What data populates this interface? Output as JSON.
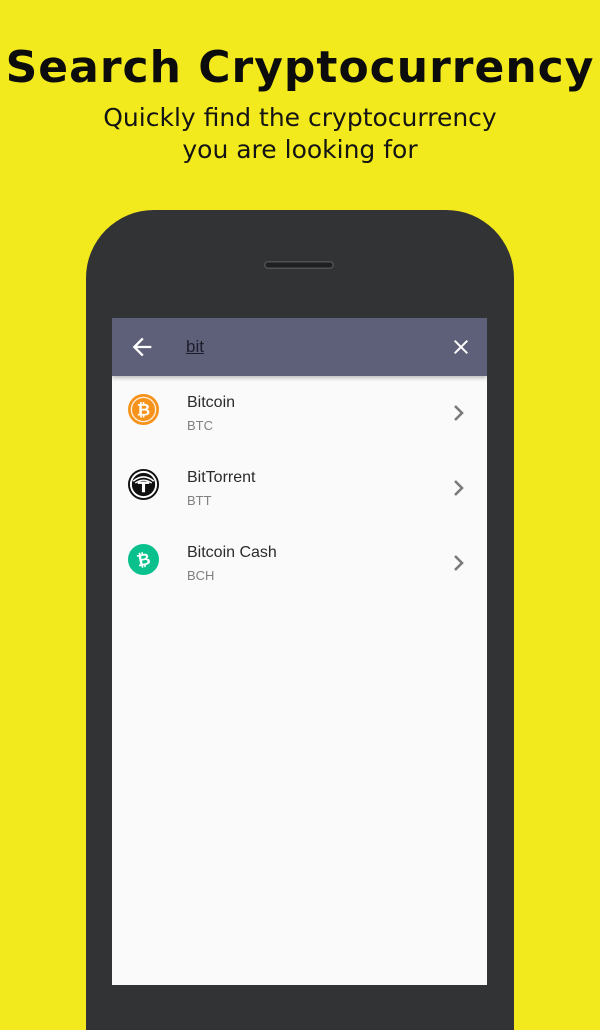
{
  "promo": {
    "title": "Search Cryptocurrency",
    "subtitle_line1": "Quickly find the cryptocurrency",
    "subtitle_line2": "you are looking for"
  },
  "search": {
    "query": "bit",
    "back_icon": "arrow-left-icon",
    "clear_icon": "close-icon"
  },
  "results": [
    {
      "name": "Bitcoin",
      "symbol": "BTC",
      "icon": "bitcoin-icon",
      "color": "#f7931a"
    },
    {
      "name": "BitTorrent",
      "symbol": "BTT",
      "icon": "bittorrent-icon",
      "color": "#111111"
    },
    {
      "name": "Bitcoin Cash",
      "symbol": "BCH",
      "icon": "bitcoin-cash-icon",
      "color": "#0ac18e"
    }
  ],
  "colors": {
    "background": "#f2ea1c",
    "phone_body": "#323334",
    "app_bar": "#5e6079",
    "screen": "#fafafa"
  }
}
